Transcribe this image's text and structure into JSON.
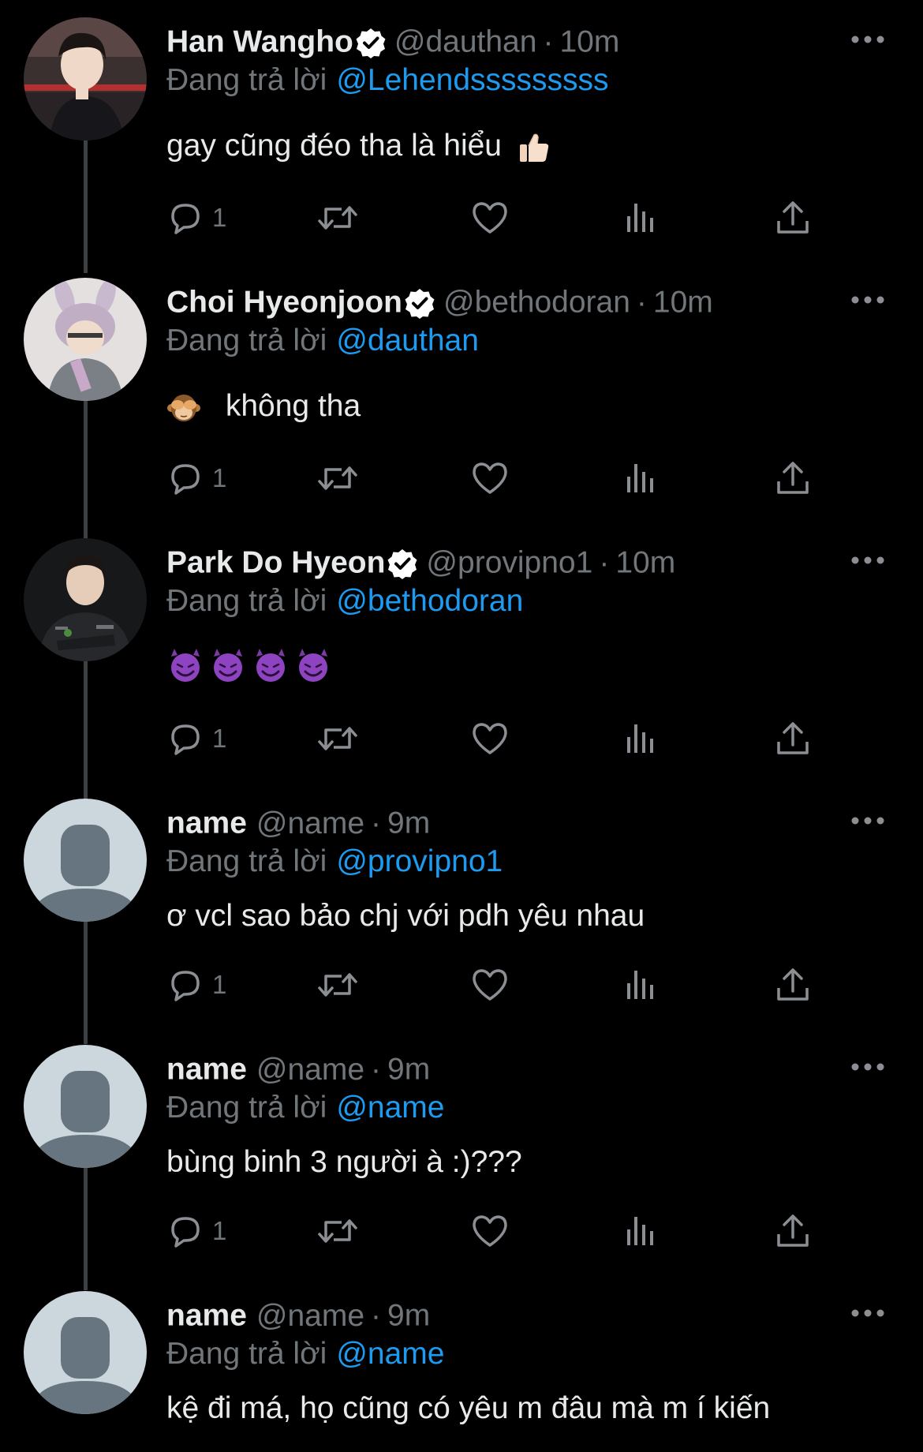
{
  "ui": {
    "reply_prefix": "Đang trả lời",
    "dot": "·"
  },
  "tweets": [
    {
      "name": "Han Wangho",
      "verified": true,
      "handle": "@dauthan",
      "time": "10m",
      "reply_to": "@Lehendsssssssss",
      "text": "gay cũng đéo tha là hiểu",
      "emoji": "thumbs-up",
      "reply_count": "1"
    },
    {
      "name": "Choi Hyeonjoon",
      "verified": true,
      "handle": "@bethodoran",
      "time": "10m",
      "reply_to": "@dauthan",
      "text": "không tha",
      "emoji": "see-no-evil-monkey",
      "reply_count": "1"
    },
    {
      "name": "Park Do Hyeon",
      "verified": true,
      "handle": "@provipno1",
      "time": "10m",
      "reply_to": "@bethodoran",
      "text": "",
      "emoji": "smiling-devil x4",
      "reply_count": "1"
    },
    {
      "name": "name",
      "verified": false,
      "handle": "@name",
      "time": "9m",
      "reply_to": "@provipno1",
      "text": "ơ vcl sao bảo chj với pdh yêu nhau",
      "reply_count": "1"
    },
    {
      "name": "name",
      "verified": false,
      "handle": "@name",
      "time": "9m",
      "reply_to": "@name",
      "text": "bùng binh 3 người à :)???",
      "reply_count": "1"
    },
    {
      "name": "name",
      "verified": false,
      "handle": "@name",
      "time": "9m",
      "reply_to": "@name",
      "text": "kệ đi má, họ cũng có yêu m đâu mà m í kiến"
    }
  ],
  "colors": {
    "background": "#000000",
    "primary_text": "#e7e9ea",
    "secondary_text": "#71767b",
    "accent": "#1d9bf0",
    "thread_line": "#3e4144",
    "default_avatar_bg": "#ccd6dd",
    "default_avatar_fg": "#66757f"
  }
}
